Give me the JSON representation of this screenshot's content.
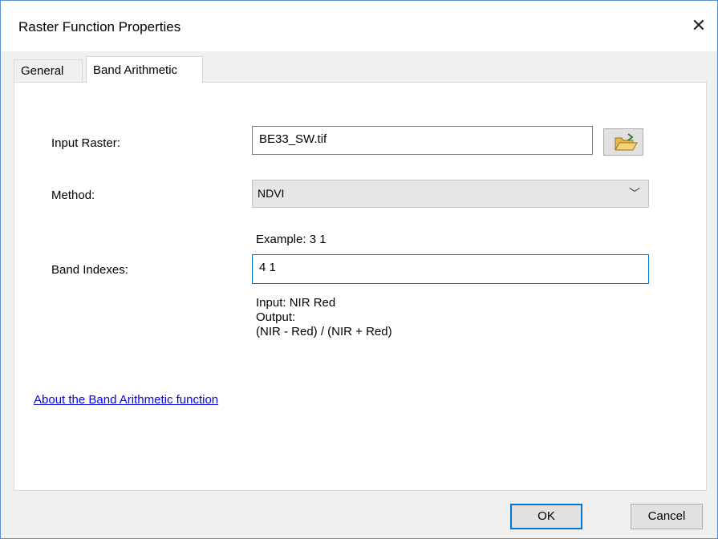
{
  "dialog": {
    "title": "Raster Function Properties",
    "close_glyph": "✕"
  },
  "tabs": [
    {
      "label": "General",
      "active": false
    },
    {
      "label": "Band Arithmetic",
      "active": true
    }
  ],
  "form": {
    "input_raster_label": "Input Raster:",
    "input_raster_value": "BE33_SW.tif",
    "method_label": "Method:",
    "method_value": "NDVI",
    "example_text": "Example: 3 1",
    "band_indexes_label": "Band Indexes:",
    "band_indexes_value": "4 1",
    "input_hint": "Input: NIR Red",
    "output_hint": "Output:",
    "formula_hint": "(NIR - Red) / (NIR + Red)"
  },
  "link": {
    "label": "About the Band Arithmetic function"
  },
  "buttons": {
    "ok": "OK",
    "cancel": "Cancel"
  },
  "icons": {
    "browse": "open-folder-icon",
    "dropdown": "chevron-down-icon"
  },
  "colors": {
    "focus": "#0078d7",
    "link": "#0000ee"
  }
}
